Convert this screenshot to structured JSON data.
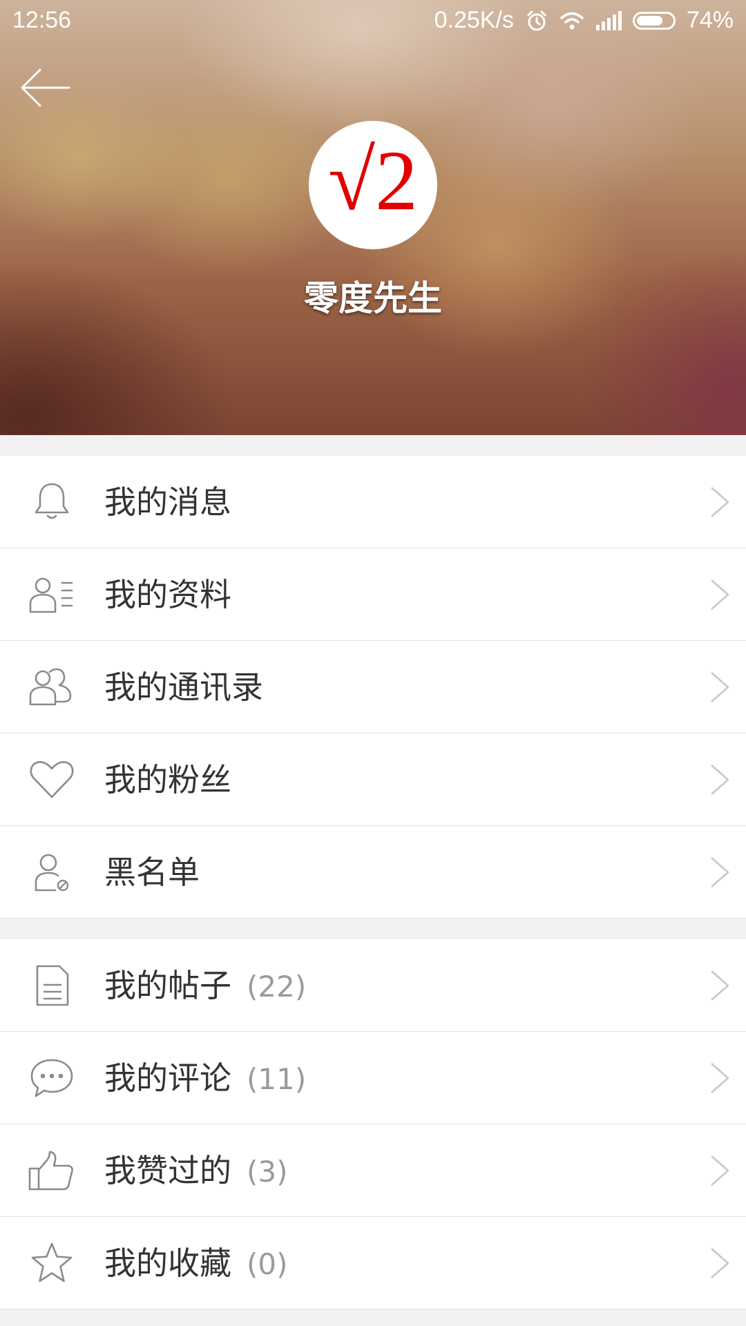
{
  "status_bar": {
    "time": "12:56",
    "net_speed": "0.25K/s",
    "battery": "74%",
    "battery_level": 0.74,
    "icons": [
      "alarm-icon",
      "wifi-icon",
      "signal-icon",
      "battery-icon"
    ]
  },
  "header": {
    "back_icon": "arrow-left-icon",
    "avatar_text": "√2",
    "username": "零度先生"
  },
  "menu_group_1": [
    {
      "icon": "bell-icon",
      "label": "我的消息",
      "count": ""
    },
    {
      "icon": "profile-card-icon",
      "label": "我的资料",
      "count": ""
    },
    {
      "icon": "contacts-icon",
      "label": "我的通讯录",
      "count": ""
    },
    {
      "icon": "heart-icon",
      "label": "我的粉丝",
      "count": ""
    },
    {
      "icon": "blocked-user-icon",
      "label": "黑名单",
      "count": ""
    }
  ],
  "menu_group_2": [
    {
      "icon": "document-icon",
      "label": "我的帖子",
      "count": "(22)"
    },
    {
      "icon": "chat-bubble-icon",
      "label": "我的评论",
      "count": "(11)"
    },
    {
      "icon": "thumbs-up-icon",
      "label": "我赞过的",
      "count": "(3)"
    },
    {
      "icon": "star-icon",
      "label": "我的收藏",
      "count": "(0)"
    }
  ],
  "colors": {
    "text_primary": "#333333",
    "text_count": "#9a9a9a",
    "icon_gray": "#8a8a8a",
    "avatar_red": "#e00000",
    "divider": "#e1e1e1",
    "page_background": "#f2f2f2"
  }
}
